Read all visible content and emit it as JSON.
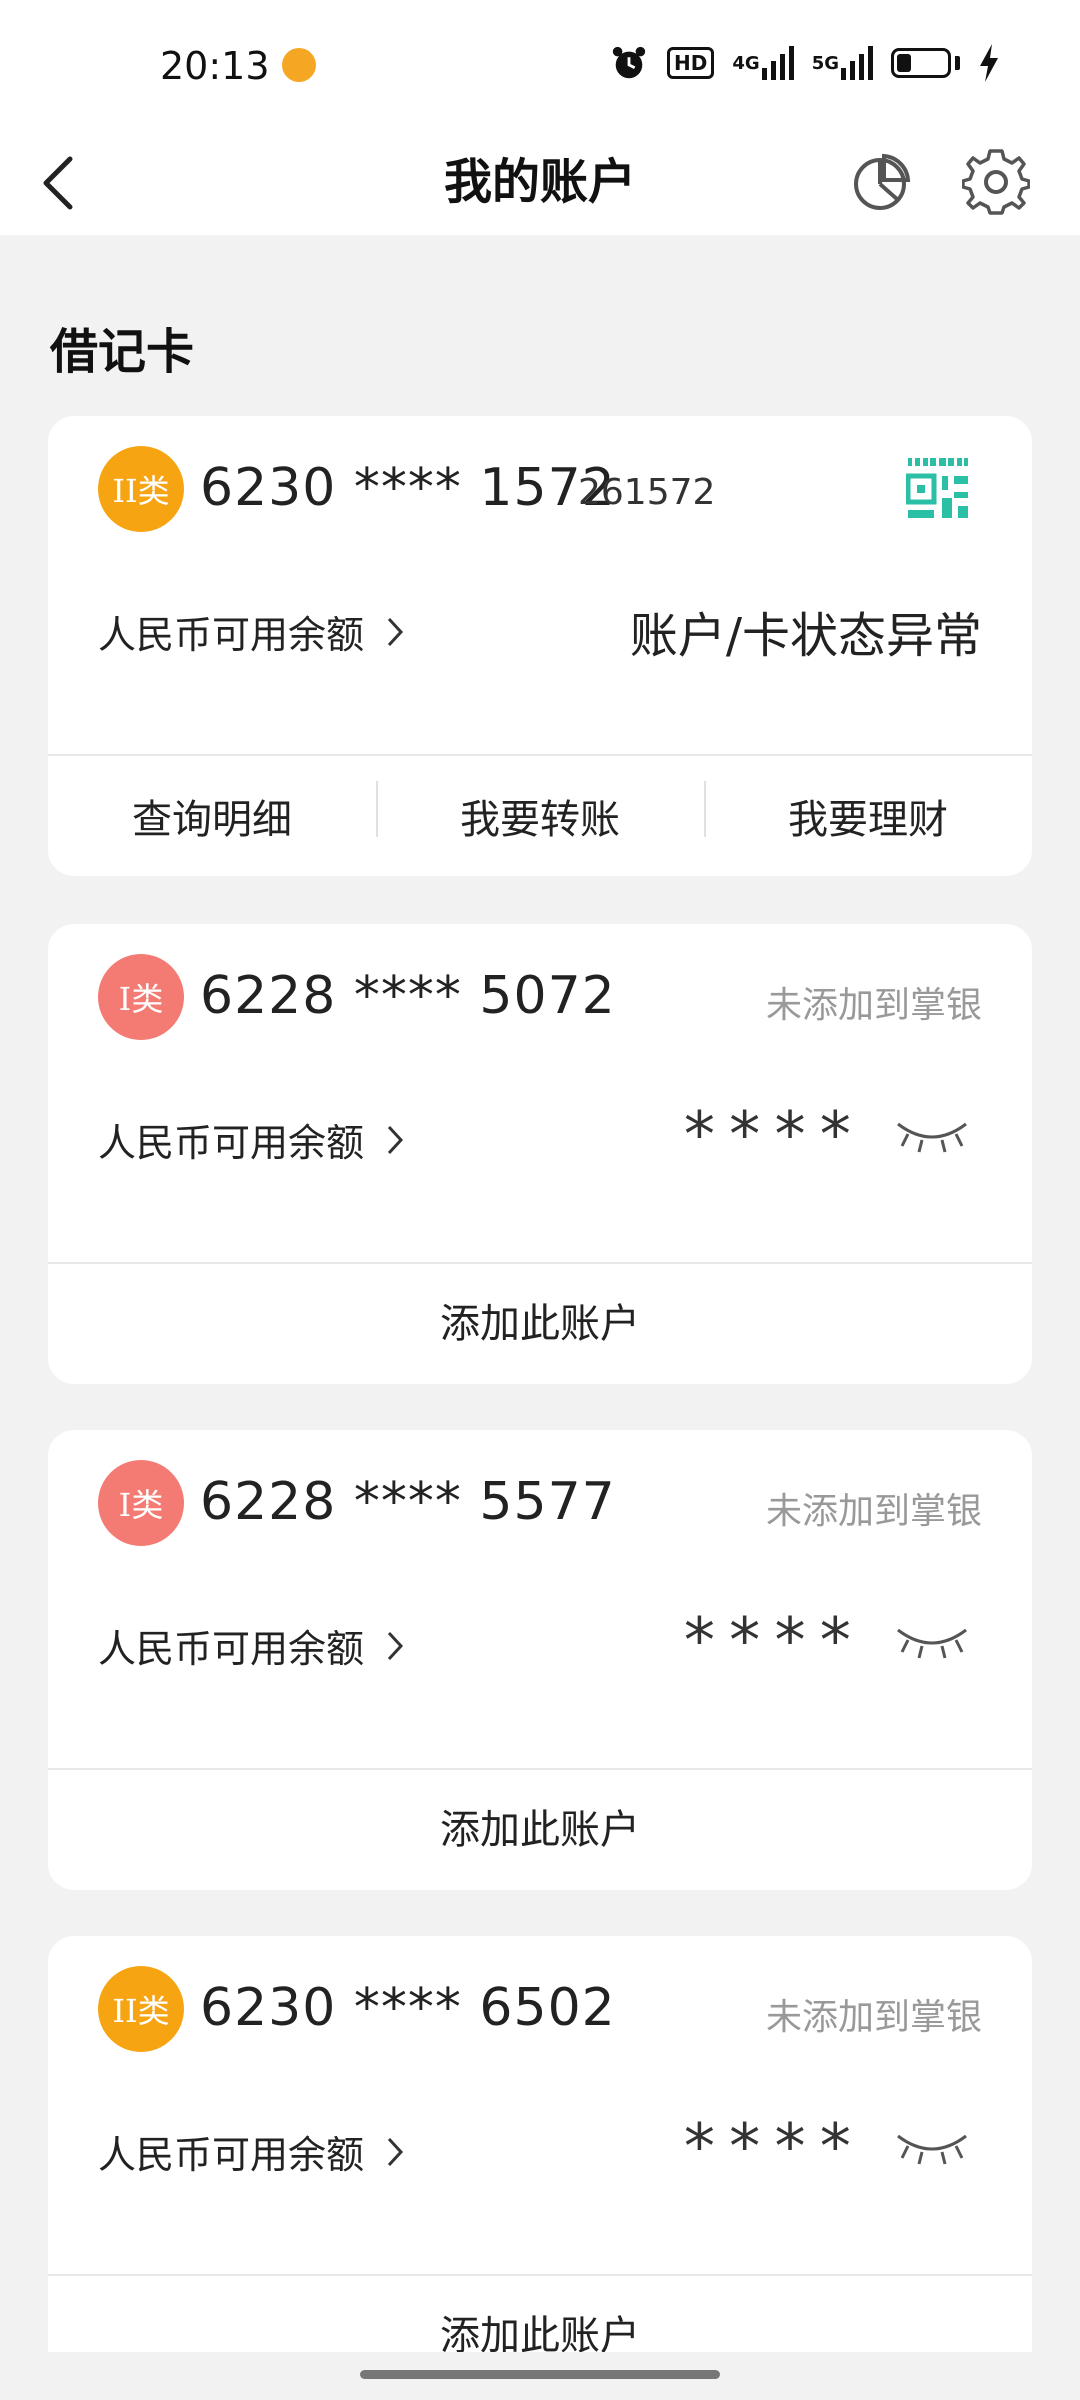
{
  "status_bar": {
    "time": "20:13",
    "hd_label": "HD",
    "net1": "4G",
    "net2": "5G"
  },
  "nav": {
    "title": "我的账户",
    "icons": [
      "back-arrow-icon",
      "pie-chart-icon",
      "gear-icon"
    ]
  },
  "section": {
    "title": "借记卡"
  },
  "balance_label": "人民币可用余额",
  "cards": [
    {
      "badge": "II类",
      "number": "6230 **** 1572",
      "suffix": "261572",
      "balance": "账户/卡状态异常",
      "actions": [
        "查询明细",
        "我要转账",
        "我要理财"
      ]
    },
    {
      "badge": "I类",
      "number": "6228 **** 5072",
      "status": "未添加到掌银",
      "balance": "****",
      "add_label": "添加此账户"
    },
    {
      "badge": "I类",
      "number": "6228 **** 5577",
      "status": "未添加到掌银",
      "balance": "****",
      "add_label": "添加此账户"
    },
    {
      "badge": "II类",
      "number": "6230 **** 6502",
      "status": "未添加到掌银",
      "balance": "****",
      "add_label": "添加此账户"
    }
  ],
  "colors": {
    "type2_badge": "#f7a413",
    "type1_badge": "#f47b73",
    "qr_teal": "#2bbfa6"
  }
}
